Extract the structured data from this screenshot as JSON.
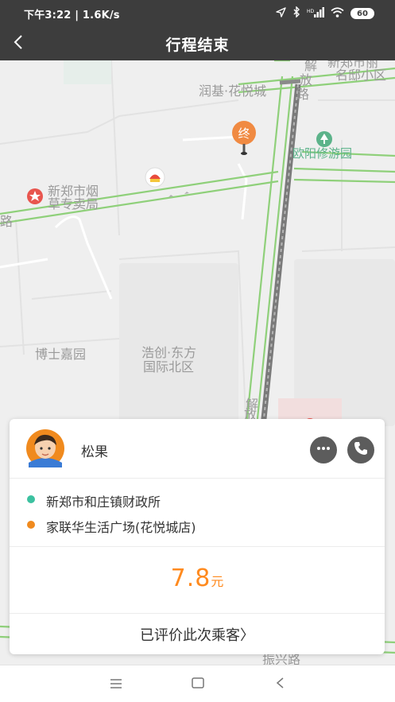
{
  "status_bar": {
    "time_speed": "下午3:22 | 1.6K/s",
    "sim_label": "HD",
    "battery": "60"
  },
  "header": {
    "title": "行程结束",
    "back_icon": "chevron-left-icon"
  },
  "map": {
    "labels": {
      "xinzheng_mingdi": "新郑市丽",
      "mingdi_district": "名邸小区",
      "runji": "润基·花悦城",
      "jiefang_road_1": "解",
      "jiefang_road_2": "放",
      "jiefang_road_3": "路",
      "ouyang_park": "欧阳修游园",
      "tobacco_1": "新郑市烟",
      "tobacco_2": "草专卖局",
      "road_cut": "路",
      "boshi": "博士嘉园",
      "haochuang_1": "浩创·东方",
      "haochuang_2": "国际北区",
      "jiefang_low_1": "解",
      "jiefang_low_2": "放",
      "zhenxing_road": "振兴路"
    },
    "end_marker": "终",
    "colors": {
      "road_green": "#8fd07a",
      "route": "#7a7a7a",
      "end_marker": "#f08a42",
      "poi_park": "#5cb38a",
      "poi_red": "#e8554e"
    }
  },
  "driver": {
    "name": "松果",
    "avatar_icon": "avatar-boy-icon",
    "message_icon": "chat-bubble-icon",
    "phone_icon": "phone-icon"
  },
  "trip": {
    "start": "新郑市和庄镇财政所",
    "end": "家联华生活广场(花悦城店)",
    "start_color": "#3cc1a0",
    "end_color": "#f08a1e"
  },
  "fare": {
    "amount": "7.8",
    "unit": "元"
  },
  "rating": {
    "label": "已评价此次乘客〉"
  },
  "system_nav": {
    "menu_icon": "menu-icon",
    "home_icon": "home-square-icon",
    "back_icon": "back-triangle-icon"
  }
}
